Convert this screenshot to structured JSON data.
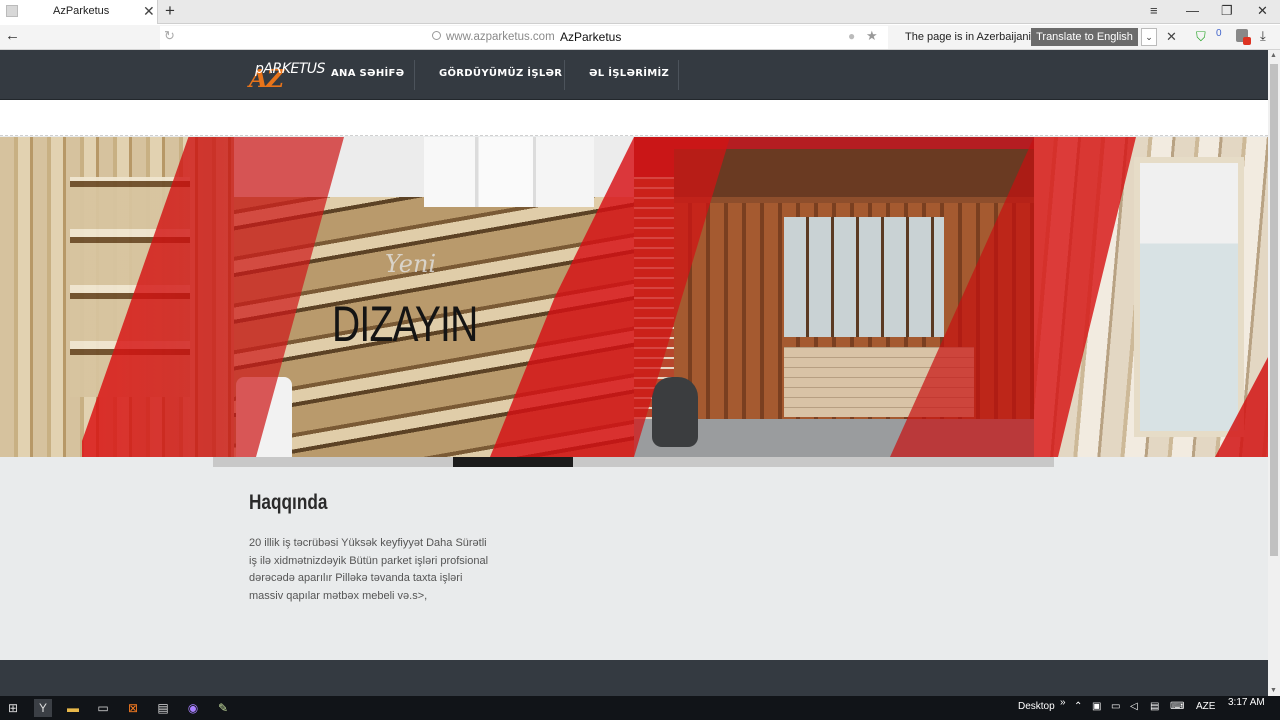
{
  "browser": {
    "tab_title": "AzParketus",
    "tab_close": "✕",
    "new_tab": "+",
    "window_controls": {
      "menu": "≡",
      "minimize": "—",
      "maximize": "❐",
      "close": "✕"
    },
    "back": "←",
    "reload_icon": "↻",
    "url_domain": "www.azparketus.com",
    "url_title": "AzParketus",
    "translate_message": "The page is in Azerbaijani",
    "translate_button": "Translate to English",
    "translate_dropdown": "⌄",
    "translate_close": "✕",
    "ext_badge": "0",
    "download_icon": "⤓"
  },
  "site": {
    "logo_big": "AZ",
    "logo_small": "pARKETUS",
    "nav": [
      "ANA SƏHİFƏ",
      "GÖRDÜYÜMÜZ İŞLƏR",
      "ƏL İŞLƏRİMİZ"
    ],
    "slider": {
      "caption_script": "Yeni",
      "caption_main": "DIZAYIN",
      "progress": 0.143
    },
    "about": {
      "title": "Haqqında",
      "text": "20 illik iş təcrübəsi Yüksək keyfiyyət Daha Sürətli iş ilə xidmətnizdəyik Bütün parket işləri profsional dərəcədə aparılır Pilləkə təvanda taxta işləri massiv qapılar mətbəx mebeli və.s>,"
    }
  },
  "taskbar": {
    "desktop_label": "Desktop",
    "chevron": "»",
    "lang": "AZE",
    "time": "3:17 AM",
    "icons": [
      "windows-start",
      "yandex-browser",
      "file-explorer",
      "command-prompt",
      "xampp",
      "app-window",
      "record-app",
      "tool-app"
    ]
  },
  "colors": {
    "nav_bg": "#343a41",
    "accent_orange": "#e8741a",
    "translate_button_bg": "#6b6b6b",
    "slider_red": "#d41414"
  }
}
